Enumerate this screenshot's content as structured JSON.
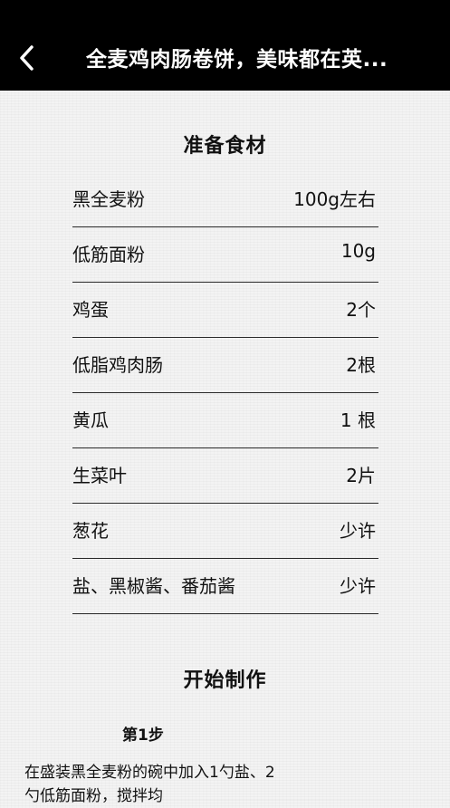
{
  "header": {
    "title": "全麦鸡肉肠卷饼，美味都在英..."
  },
  "icons": {
    "back": "chevron-left-icon"
  },
  "ingredients_section": {
    "title": "准备食材",
    "items": [
      {
        "name": "黑全麦粉",
        "qty": "100g左右"
      },
      {
        "name": "低筋面粉",
        "qty": "10g"
      },
      {
        "name": "鸡蛋",
        "qty": "2个"
      },
      {
        "name": "低脂鸡肉肠",
        "qty": "2根"
      },
      {
        "name": "黄瓜",
        "qty": "1 根"
      },
      {
        "name": "生菜叶",
        "qty": "2片"
      },
      {
        "name": "葱花",
        "qty": "少许"
      },
      {
        "name": "盐、黑椒酱、番茄酱",
        "qty": "少许"
      }
    ]
  },
  "steps_section": {
    "title": "开始制作",
    "steps": [
      {
        "label": "第1步",
        "text": "在盛装黑全麦粉的碗中加入1勺盐、2勺低筋面粉，搅拌均"
      }
    ]
  }
}
